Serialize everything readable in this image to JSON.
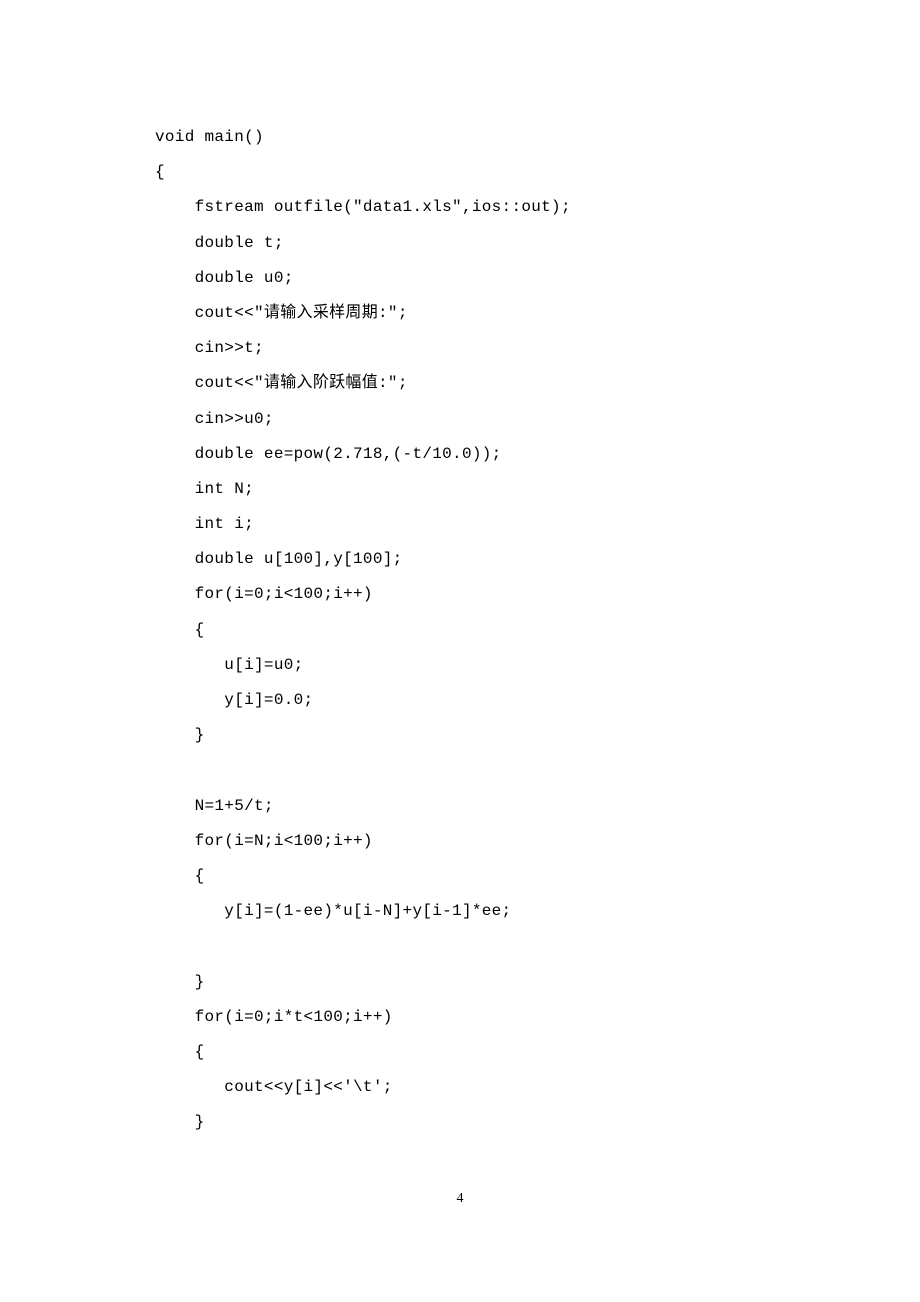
{
  "code": {
    "lines": [
      "void main()",
      "{",
      "    fstream outfile(\"data1.xls\",ios::out);",
      "    double t;",
      "    double u0;",
      "    cout<<\"请输入采样周期:\";",
      "    cin>>t;",
      "    cout<<\"请输入阶跃幅值:\";",
      "    cin>>u0;",
      "    double ee=pow(2.718,(-t/10.0));",
      "    int N;",
      "    int i;",
      "    double u[100],y[100];",
      "    for(i=0;i<100;i++)",
      "    {",
      "       u[i]=u0;",
      "       y[i]=0.0;",
      "    }",
      "",
      "    N=1+5/t;",
      "    for(i=N;i<100;i++)",
      "    {",
      "       y[i]=(1-ee)*u[i-N]+y[i-1]*ee;",
      "",
      "    }",
      "    for(i=0;i*t<100;i++)",
      "    {",
      "       cout<<y[i]<<'\\t';",
      "    }"
    ]
  },
  "page_number": "4"
}
